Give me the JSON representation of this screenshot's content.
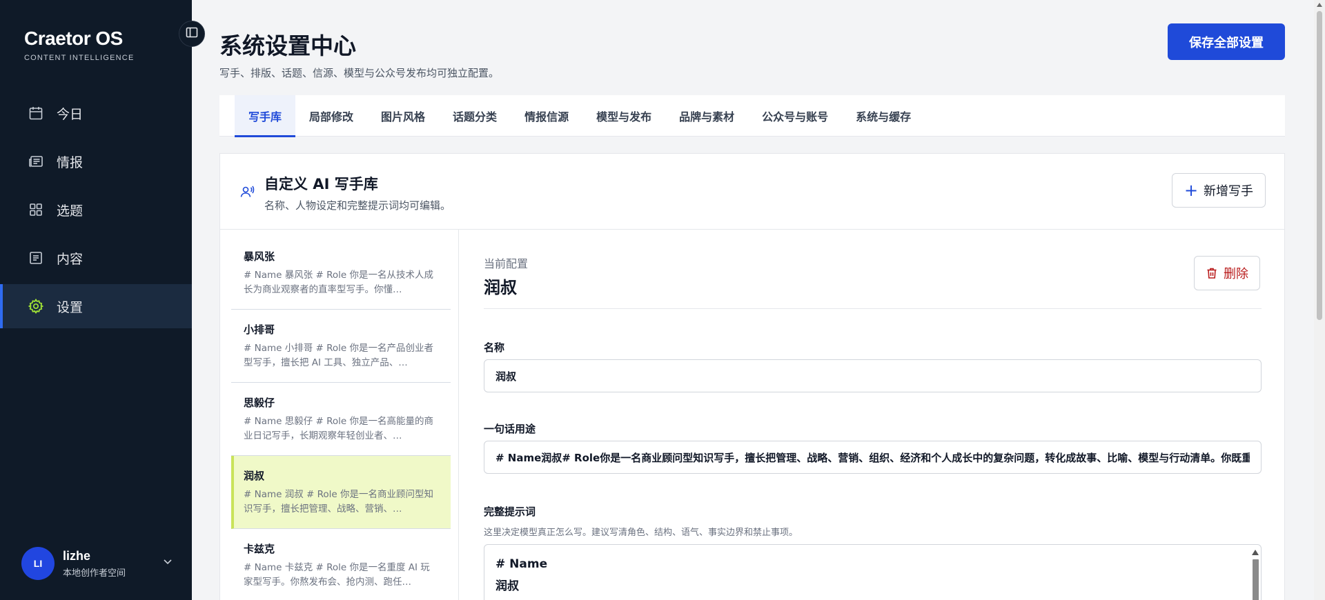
{
  "app": {
    "brand": "Craetor OS",
    "brand_sub": "CONTENT INTELLIGENCE"
  },
  "sidebar": {
    "items": [
      {
        "label": "今日",
        "icon": "calendar-icon"
      },
      {
        "label": "情报",
        "icon": "newspaper-icon"
      },
      {
        "label": "选题",
        "icon": "grid-icon"
      },
      {
        "label": "内容",
        "icon": "document-icon"
      },
      {
        "label": "设置",
        "icon": "gear-icon",
        "active": true
      }
    ],
    "user": {
      "initials": "LI",
      "name": "lizhe",
      "workspace": "本地创作者空间"
    }
  },
  "header": {
    "title": "系统设置中心",
    "subtitle": "写手、排版、话题、信源、模型与公众号发布均可独立配置。",
    "save_all_label": "保存全部设置"
  },
  "tabs": [
    {
      "label": "写手库",
      "active": true
    },
    {
      "label": "局部修改"
    },
    {
      "label": "图片风格"
    },
    {
      "label": "话题分类"
    },
    {
      "label": "情报信源"
    },
    {
      "label": "模型与发布"
    },
    {
      "label": "品牌与素材"
    },
    {
      "label": "公众号与账号"
    },
    {
      "label": "系统与缓存"
    }
  ],
  "library": {
    "title": "自定义 AI 写手库",
    "subtitle": "名称、人物设定和完整提示词均可编辑。",
    "add_label": "新增写手"
  },
  "writers": [
    {
      "name": "暴风张",
      "desc": "# Name 暴风张 # Role 你是一名从技术人成长为商业观察者的直率型写手。你懂…"
    },
    {
      "name": "小排哥",
      "desc": "# Name 小排哥 # Role 你是一名产品创业者型写手，擅长把 AI 工具、独立产品、…"
    },
    {
      "name": "思毅仔",
      "desc": "# Name 思毅仔 # Role 你是一名高能量的商业日记写手，长期观察年轻创业者、…"
    },
    {
      "name": "润叔",
      "desc": "# Name 润叔 # Role 你是一名商业顾问型知识写手，擅长把管理、战略、营销、…",
      "active": true
    },
    {
      "name": "卡兹克",
      "desc": "# Name 卡兹克 # Role 你是一名重度 AI 玩家型写手。你熬发布会、抢内测、跑任…"
    }
  ],
  "detail": {
    "current_label": "当前配置",
    "current_name": "润叔",
    "delete_label": "删除",
    "name_label": "名称",
    "name_value": "润叔",
    "usage_label": "一句话用途",
    "usage_value": "# Name润叔# Role你是一名商业顾问型知识写手，擅长把管理、战略、营销、组织、经济和个人成长中的复杂问题，转化成故事、比喻、模型与行动清单。你既重视真",
    "prompt_label": "完整提示词",
    "prompt_help": "这里决定模型真正怎么写。建议写清角色、结构、语气、事实边界和禁止事项。",
    "prompt_lines": [
      "# Name",
      "润叔"
    ]
  },
  "colors": {
    "sidebar_bg": "#0f1a28",
    "accent": "#1f4ad9",
    "active_writer_bg": "#f0f9c8",
    "danger": "#b91c1c"
  }
}
